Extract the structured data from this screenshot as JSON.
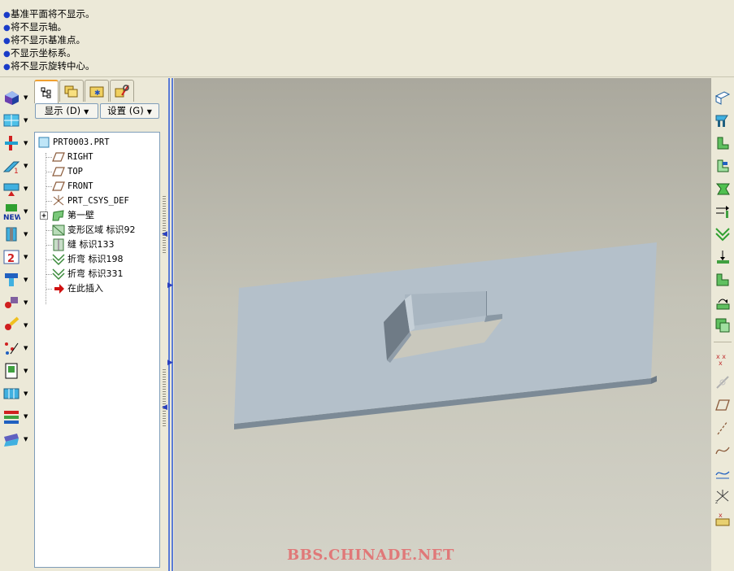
{
  "messages": [
    "基准平面将不显示。",
    "将不显示轴。",
    "将不显示基准点。",
    "不显示坐标系。",
    "将不显示旋转中心。"
  ],
  "nav": {
    "show_label": "显示",
    "show_key": "(D)",
    "settings_label": "设置",
    "settings_key": "(G)"
  },
  "tree": {
    "root": "PRT0003.PRT",
    "items": [
      {
        "label": "RIGHT",
        "icon": "datum-plane-icon"
      },
      {
        "label": "TOP",
        "icon": "datum-plane-icon"
      },
      {
        "label": "FRONT",
        "icon": "datum-plane-icon"
      },
      {
        "label": "PRT_CSYS_DEF",
        "icon": "csys-icon"
      },
      {
        "label": "第一壁",
        "icon": "first-wall-icon"
      },
      {
        "label": "变形区域 标识92",
        "icon": "deform-area-icon"
      },
      {
        "label": "缝 标识133",
        "icon": "rip-icon"
      },
      {
        "label": "折弯 标识198",
        "icon": "bend-icon"
      },
      {
        "label": "折弯 标识331",
        "icon": "bend-icon"
      },
      {
        "label": "在此插入",
        "icon": "insert-here-icon"
      }
    ]
  },
  "watermark": "BBS.CHINADE.NET",
  "colors": {
    "part_top": "#b4c0ca",
    "part_edge": "#7c8a96",
    "bullet": "#1a3cc8",
    "watermark": "#e07878"
  }
}
